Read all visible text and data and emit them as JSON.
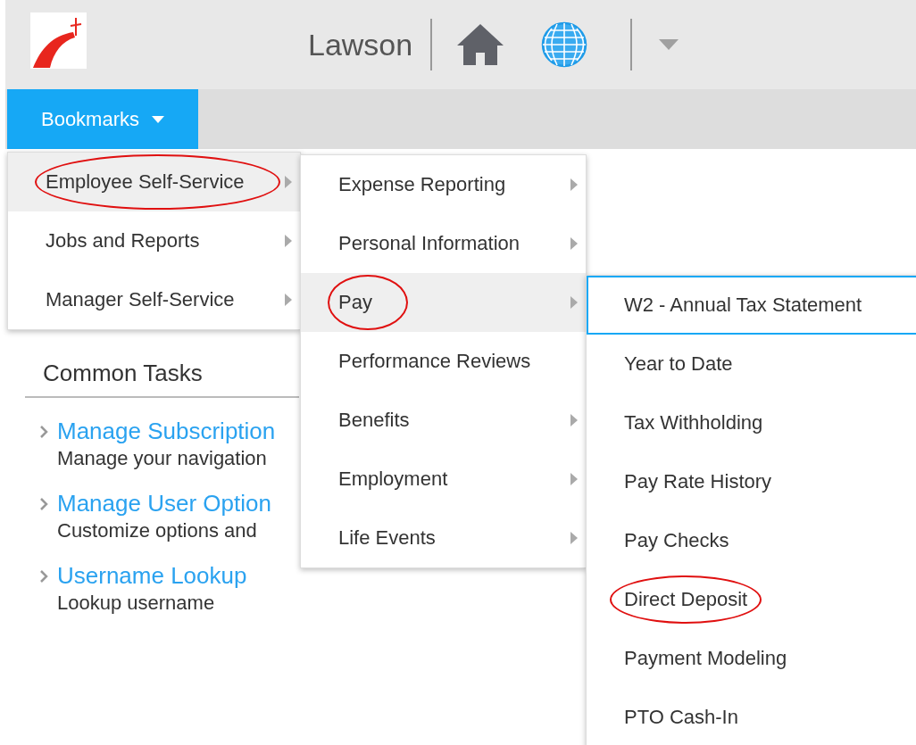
{
  "header": {
    "title": "Lawson"
  },
  "bookmarks": {
    "label": "Bookmarks",
    "items": [
      {
        "label": "Employee Self-Service",
        "has_submenu": true,
        "selected": true,
        "circled": true,
        "children": [
          {
            "label": "Expense Reporting",
            "has_submenu": true,
            "selected": false,
            "circled": false
          },
          {
            "label": "Personal Information",
            "has_submenu": true,
            "selected": false,
            "circled": false
          },
          {
            "label": "Pay",
            "has_submenu": true,
            "selected": true,
            "circled": true,
            "children": [
              {
                "label": "W2 - Annual Tax Statement",
                "focused": true,
                "circled": false
              },
              {
                "label": "Year to Date",
                "focused": false,
                "circled": false
              },
              {
                "label": "Tax Withholding",
                "focused": false,
                "circled": false
              },
              {
                "label": "Pay Rate History",
                "focused": false,
                "circled": false
              },
              {
                "label": "Pay Checks",
                "focused": false,
                "circled": false
              },
              {
                "label": "Direct Deposit",
                "focused": false,
                "circled": true
              },
              {
                "label": "Payment Modeling",
                "focused": false,
                "circled": false
              },
              {
                "label": "PTO Cash-In",
                "focused": false,
                "circled": false
              }
            ]
          },
          {
            "label": "Performance Reviews",
            "has_submenu": false,
            "selected": false,
            "circled": false
          },
          {
            "label": "Benefits",
            "has_submenu": true,
            "selected": false,
            "circled": false
          },
          {
            "label": "Employment",
            "has_submenu": true,
            "selected": false,
            "circled": false
          },
          {
            "label": "Life Events",
            "has_submenu": true,
            "selected": false,
            "circled": false
          }
        ]
      },
      {
        "label": "Jobs and Reports",
        "has_submenu": true,
        "selected": false,
        "circled": false
      },
      {
        "label": "Manager Self-Service",
        "has_submenu": true,
        "selected": false,
        "circled": false
      }
    ]
  },
  "common_tasks": {
    "title": "Common Tasks",
    "tasks": [
      {
        "link": "Manage Subscription",
        "description": "Manage your navigation"
      },
      {
        "link": "Manage User Option",
        "description": "Customize options and"
      },
      {
        "link": "Username Lookup",
        "description": "Lookup username"
      }
    ]
  }
}
